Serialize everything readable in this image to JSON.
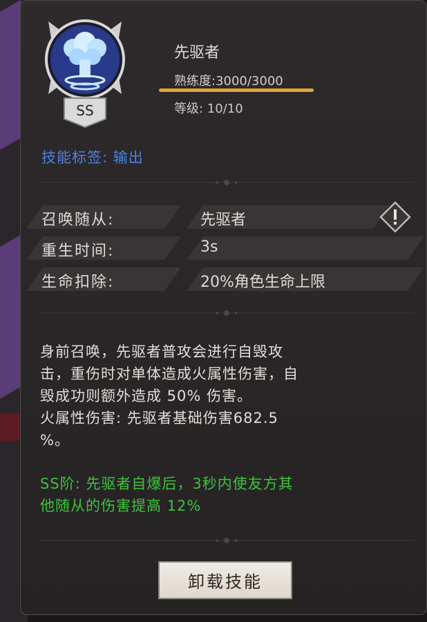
{
  "skill": {
    "name": "先驱者",
    "proficiency": "熟练度:3000/3000",
    "proficiency_fill": 1.0,
    "level": "等级: 10/10",
    "grade_badge": "SS",
    "icon": "mushroom-cloud-icon"
  },
  "tag_line": "技能标签:  输出",
  "stats": [
    {
      "label": "召唤随从:",
      "value": "先驱者"
    },
    {
      "label": "重生时间:",
      "value": "3s"
    },
    {
      "label": "生命扣除:",
      "value": "20%角色生命上限"
    }
  ],
  "warning_icon": "exclamation-diamond-icon",
  "description": "身前召唤，先驱者普攻会进行自毁攻\n击，重伤时对单体造成火属性伤害，自\n毁成功则额外造成 50% 伤害。\n火属性伤害: 先驱者基础伤害682.5\n%。",
  "ss_bonus": "SS阶: 先驱者自爆后，3秒内使友方其\n他随从的伤害提高 12%",
  "unload_button": "卸载技能",
  "colors": {
    "tag": "#4c82e0",
    "ss_text": "#3cc43c",
    "proficiency_bar": "#e0a43a",
    "panel": "#2b2728"
  }
}
